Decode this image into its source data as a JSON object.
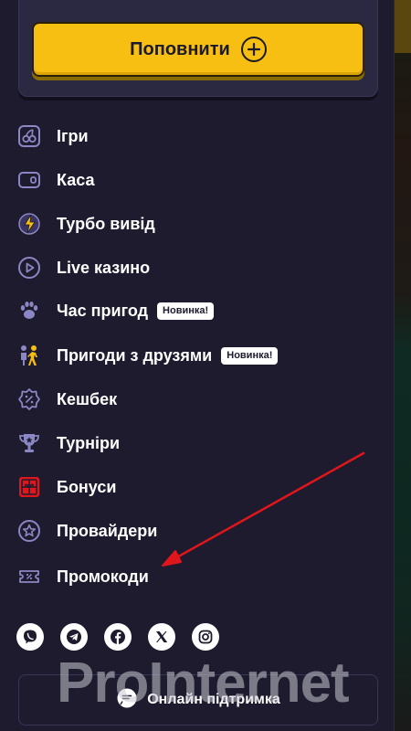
{
  "topup": {
    "label": "Поповнити"
  },
  "menu": {
    "items": [
      {
        "label": "Ігри",
        "icon": "cherries-icon"
      },
      {
        "label": "Каса",
        "icon": "wallet-icon"
      },
      {
        "label": "Турбо вивід",
        "icon": "lightning-icon"
      },
      {
        "label": "Live казино",
        "icon": "play-icon"
      },
      {
        "label": "Час пригод",
        "icon": "paw-icon",
        "badge": "Новинка!"
      },
      {
        "label": "Пригоди з друзями",
        "icon": "people-icon",
        "badge": "Новинка!"
      },
      {
        "label": "Кешбек",
        "icon": "cashback-icon"
      },
      {
        "label": "Турніри",
        "icon": "trophy-icon"
      },
      {
        "label": "Бонуси",
        "icon": "gift-icon"
      },
      {
        "label": "Провайдери",
        "icon": "star-icon"
      },
      {
        "label": "Промокоди",
        "icon": "coupon-icon"
      }
    ]
  },
  "socials": [
    "viber-icon",
    "telegram-icon",
    "facebook-icon",
    "x-icon",
    "instagram-icon"
  ],
  "support": {
    "label": "Онлайн підтримка"
  },
  "watermark": "ProInternet",
  "colors": {
    "accent": "#f6bf12",
    "panel": "#1e1b2e",
    "icon": "#8b87c4",
    "arrow": "#e0161c"
  }
}
